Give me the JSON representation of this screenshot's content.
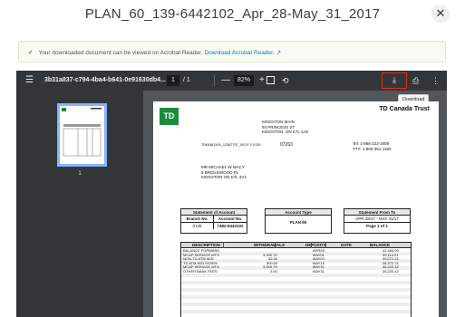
{
  "window": {
    "title": "PLAN_60_139-6442102_Apr_28-May_31_2017",
    "close_glyph": "✕"
  },
  "notice": {
    "check_glyph": "✓",
    "text": "Your downloaded document can be viewed on Acrobat Reader.",
    "link": "Download Acrobat Reader.",
    "link_icon": "↗"
  },
  "toolbar": {
    "menu_glyph": "☰",
    "doc_name": "3b31a837-c794-4ba4-b641-0e91630db4...",
    "page_current": "1",
    "page_total": "/ 1",
    "zoom_out": "—",
    "zoom_value": "82%",
    "zoom_in": "+",
    "rotate_glyph": "⟲",
    "download_glyph": "⤓",
    "print_glyph": "⎙",
    "more_glyph": "⋮",
    "tooltip": "Download"
  },
  "sidebar": {
    "thumb_label": "1"
  },
  "document": {
    "logo": "TD",
    "bank_name": "TD Canada Trust",
    "branch_address": [
      "KINGSTON MAIN",
      "94 PRINCESS ST",
      "KINGSTON, ON K7L 1A5"
    ],
    "tel": [
      "Tel:      1-866-222-3456",
      "TTY:     1-800-361-1180"
    ],
    "ref": "T04B481400_12587757_001 E 0 0139",
    "acct_short": "07263",
    "customer": [
      "MR MICHAEL W MACY",
      "5 BRIDLEWOOD PL",
      "KINGSTON  ON  K7L 4V1"
    ],
    "statement_of_account": {
      "header": "Statement of Account",
      "branch_label": "Branch No.",
      "account_label": "Account No.",
      "branch_no": "0139",
      "account_no": "7482-6442102"
    },
    "account_type": {
      "header": "Account Type",
      "value": "PLAN 60"
    },
    "statement_from": {
      "header": "Statement From  To",
      "value": "APR 28/17 - MAY 31/17",
      "page": "Page 1 of 1"
    },
    "columns": [
      "DESCRIPTION",
      "WITHDRAWALS",
      "DEPOSITS",
      "DATE",
      "BALANCE"
    ],
    "rows": [
      {
        "desc": "BALANCE FORWARD",
        "wd": "",
        "dep": "",
        "date": "APR28",
        "bal": "42,464.00"
      },
      {
        "desc": "MCAP SERVICE    MTG",
        "wd": "3,349.79",
        "dep": "",
        "date": "MAY01",
        "bal": "39,114.21"
      },
      {
        "desc": "NON-TD ATM W/D",
        "wd": "42.00",
        "dep": "",
        "date": "MAY03",
        "bal": "39,072.21"
      },
      {
        "desc": "TD ATM W/D    002905",
        "wd": "500.00",
        "dep": "",
        "date": "MAY15",
        "bal": "38,572.21"
      },
      {
        "desc": "MCAP SERVICE    MTG",
        "wd": "3,349.79",
        "dep": "",
        "date": "MAY31",
        "bal": "35,222.42"
      },
      {
        "desc": "OTHER BANK FEES",
        "wd": "2.00",
        "dep": "",
        "date": "MAY31",
        "bal": "35,220.42"
      }
    ]
  }
}
